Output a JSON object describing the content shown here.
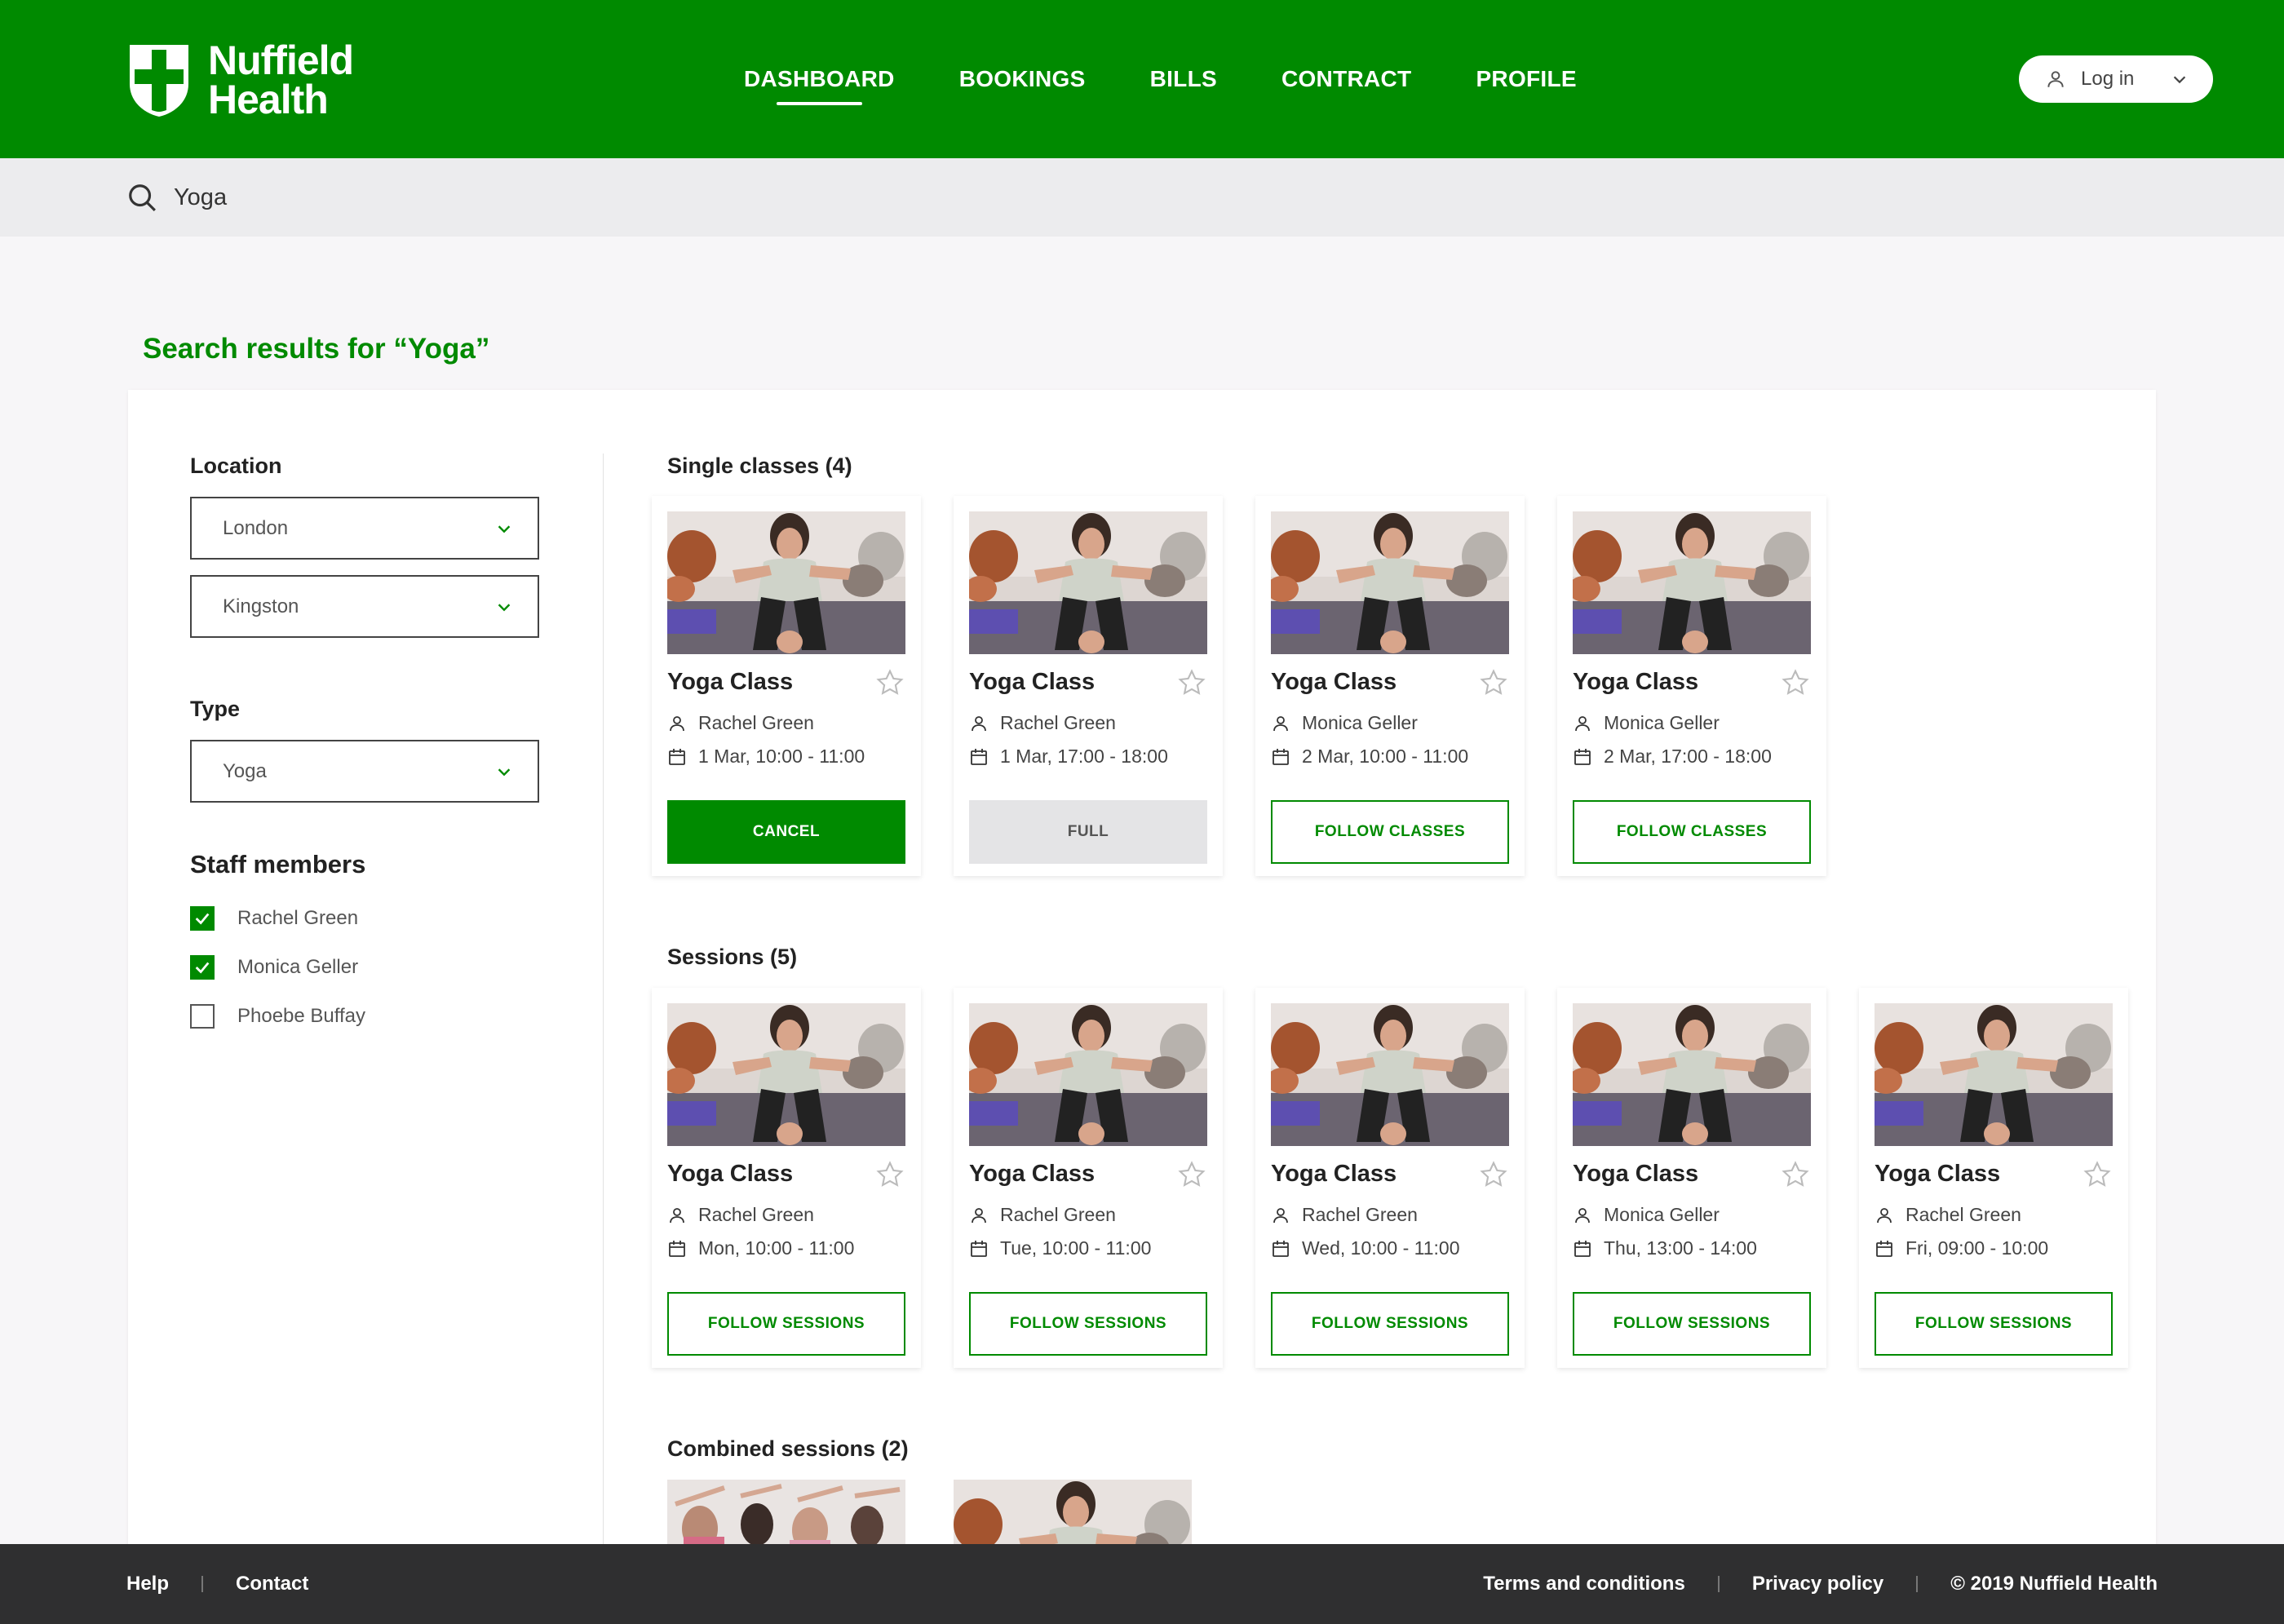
{
  "header": {
    "logo_line1": "Nuffield",
    "logo_line2": "Health",
    "nav": [
      "DASHBOARD",
      "BOOKINGS",
      "BILLS",
      "CONTRACT",
      "PROFILE"
    ],
    "active_nav": "DASHBOARD",
    "login_label": "Log in"
  },
  "search": {
    "value": "Yoga"
  },
  "results_title": "Search results for “Yoga”",
  "filters": {
    "location_label": "Location",
    "location_1": "London",
    "location_2": "Kingston",
    "type_label": "Type",
    "type_value": "Yoga",
    "staff_label": "Staff members",
    "staff": [
      {
        "name": "Rachel Green",
        "checked": true
      },
      {
        "name": "Monica Geller",
        "checked": true
      },
      {
        "name": "Phoebe Buffay",
        "checked": false
      }
    ]
  },
  "single_classes": {
    "title": "Single classes (4)",
    "cards": [
      {
        "title": "Yoga Class",
        "instructor": "Rachel Green",
        "when": "1 Mar, 10:00 - 11:00",
        "button": "CANCEL",
        "style": "primary"
      },
      {
        "title": "Yoga Class",
        "instructor": "Rachel Green",
        "when": "1 Mar, 17:00 - 18:00",
        "button": "FULL",
        "style": "disabled"
      },
      {
        "title": "Yoga Class",
        "instructor": "Monica Geller",
        "when": "2 Mar, 10:00 - 11:00",
        "button": "FOLLOW CLASSES",
        "style": "outline"
      },
      {
        "title": "Yoga Class",
        "instructor": "Monica Geller",
        "when": "2 Mar, 17:00 - 18:00",
        "button": "FOLLOW CLASSES",
        "style": "outline"
      }
    ]
  },
  "sessions": {
    "title": "Sessions (5)",
    "cards": [
      {
        "title": "Yoga Class",
        "instructor": "Rachel Green",
        "when": "Mon, 10:00 - 11:00",
        "button": "FOLLOW SESSIONS",
        "style": "outline"
      },
      {
        "title": "Yoga Class",
        "instructor": "Rachel Green",
        "when": "Tue, 10:00 - 11:00",
        "button": "FOLLOW SESSIONS",
        "style": "outline"
      },
      {
        "title": "Yoga Class",
        "instructor": "Rachel Green",
        "when": "Wed, 10:00 - 11:00",
        "button": "FOLLOW SESSIONS",
        "style": "outline"
      },
      {
        "title": "Yoga Class",
        "instructor": "Monica Geller",
        "when": "Thu, 13:00 - 14:00",
        "button": "FOLLOW SESSIONS",
        "style": "outline"
      },
      {
        "title": "Yoga Class",
        "instructor": "Rachel Green",
        "when": "Fri, 09:00 - 10:00",
        "button": "FOLLOW SESSIONS",
        "style": "outline"
      }
    ]
  },
  "combined_sessions": {
    "title": "Combined sessions (2)"
  },
  "footer": {
    "help": "Help",
    "contact": "Contact",
    "terms": "Terms and conditions",
    "privacy": "Privacy policy",
    "copyright": "© 2019 Nuffield Health"
  },
  "colors": {
    "brand": "#008a00",
    "footer": "#2f2f30",
    "search_bg": "#ececee"
  },
  "icons": [
    "search-icon",
    "user-icon",
    "chevron-down-icon",
    "star-icon",
    "calendar-icon",
    "check-icon"
  ]
}
